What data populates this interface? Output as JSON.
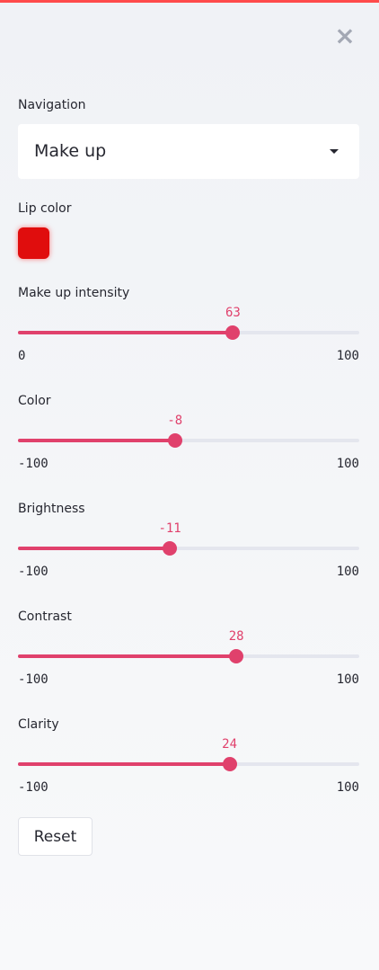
{
  "header": {
    "close_icon": "close-icon"
  },
  "navigation": {
    "label": "Navigation",
    "selected": "Make up"
  },
  "lip_color": {
    "label": "Lip color",
    "color": "#e00d0d"
  },
  "accent_color": "#e0416c",
  "sliders": [
    {
      "id": "make-up-intensity",
      "label": "Make up intensity",
      "value": 63,
      "min": 0,
      "max": 100,
      "value_text": "63",
      "min_text": "0",
      "max_text": "100"
    },
    {
      "id": "color",
      "label": "Color",
      "value": -8,
      "min": -100,
      "max": 100,
      "value_text": "-8",
      "min_text": "-100",
      "max_text": "100"
    },
    {
      "id": "brightness",
      "label": "Brightness",
      "value": -11,
      "min": -100,
      "max": 100,
      "value_text": "-11",
      "min_text": "-100",
      "max_text": "100"
    },
    {
      "id": "contrast",
      "label": "Contrast",
      "value": 28,
      "min": -100,
      "max": 100,
      "value_text": "28",
      "min_text": "-100",
      "max_text": "100"
    },
    {
      "id": "clarity",
      "label": "Clarity",
      "value": 24,
      "min": -100,
      "max": 100,
      "value_text": "24",
      "min_text": "-100",
      "max_text": "100"
    }
  ],
  "reset": {
    "label": "Reset"
  }
}
